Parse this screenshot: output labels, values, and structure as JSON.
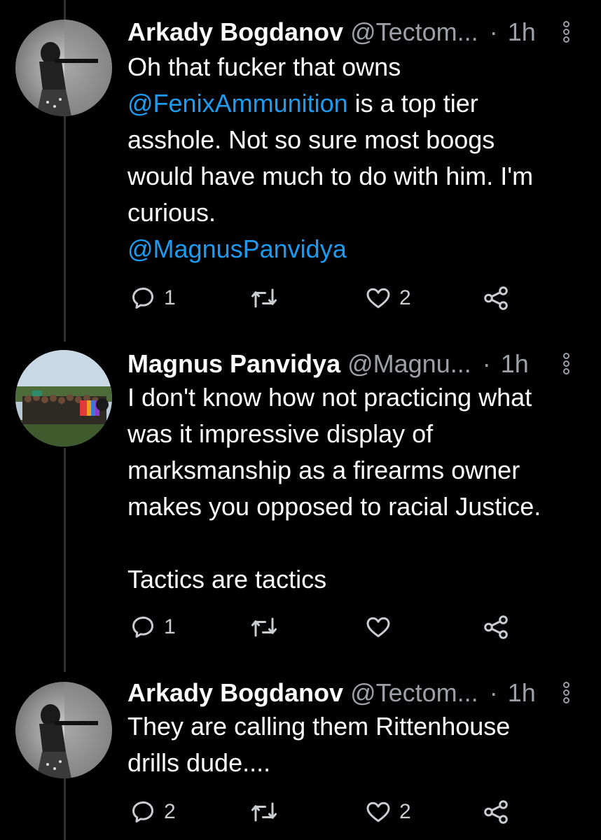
{
  "tweets": [
    {
      "name": "Arkady Bogdanov",
      "handle": "@Tectom...",
      "separator": "·",
      "time": "1h",
      "lines": [
        "Oh that fucker that owns"
      ],
      "mention1": "@FenixAmmunition",
      "line2_rest": " is a top tier",
      "line3": "asshole. Not so sure most boogs",
      "line4": "would have much to do with him. I'm",
      "line5": "curious.",
      "mention2": "@MagnusPanvidya",
      "replies": "1",
      "retweets": "",
      "likes": "2"
    },
    {
      "name": "Magnus Panvidya",
      "handle": "@Magnu...",
      "separator": "·",
      "time": "1h",
      "line1": "I don't know how not practicing what",
      "line2": "was it impressive display of",
      "line3": "marksmanship as a firearms owner",
      "line4": "makes you opposed to racial Justice.",
      "line5": "Tactics are tactics",
      "replies": "1",
      "retweets": "",
      "likes": ""
    },
    {
      "name": "Arkady Bogdanov",
      "handle": "@Tectom...",
      "separator": "·",
      "time": "1h",
      "line1": "They are calling them Rittenhouse",
      "line2": "drills dude....",
      "replies": "2",
      "retweets": "",
      "likes": "2"
    }
  ],
  "icons": {
    "reply": "reply-icon",
    "retweet": "retweet-icon",
    "like": "heart-icon",
    "share": "share-icon",
    "more": "more-vertical-icon"
  },
  "colors": {
    "background": "#000000",
    "text": "#ffffff",
    "secondary": "#9ba1a6",
    "mention": "#1d9bf0"
  }
}
